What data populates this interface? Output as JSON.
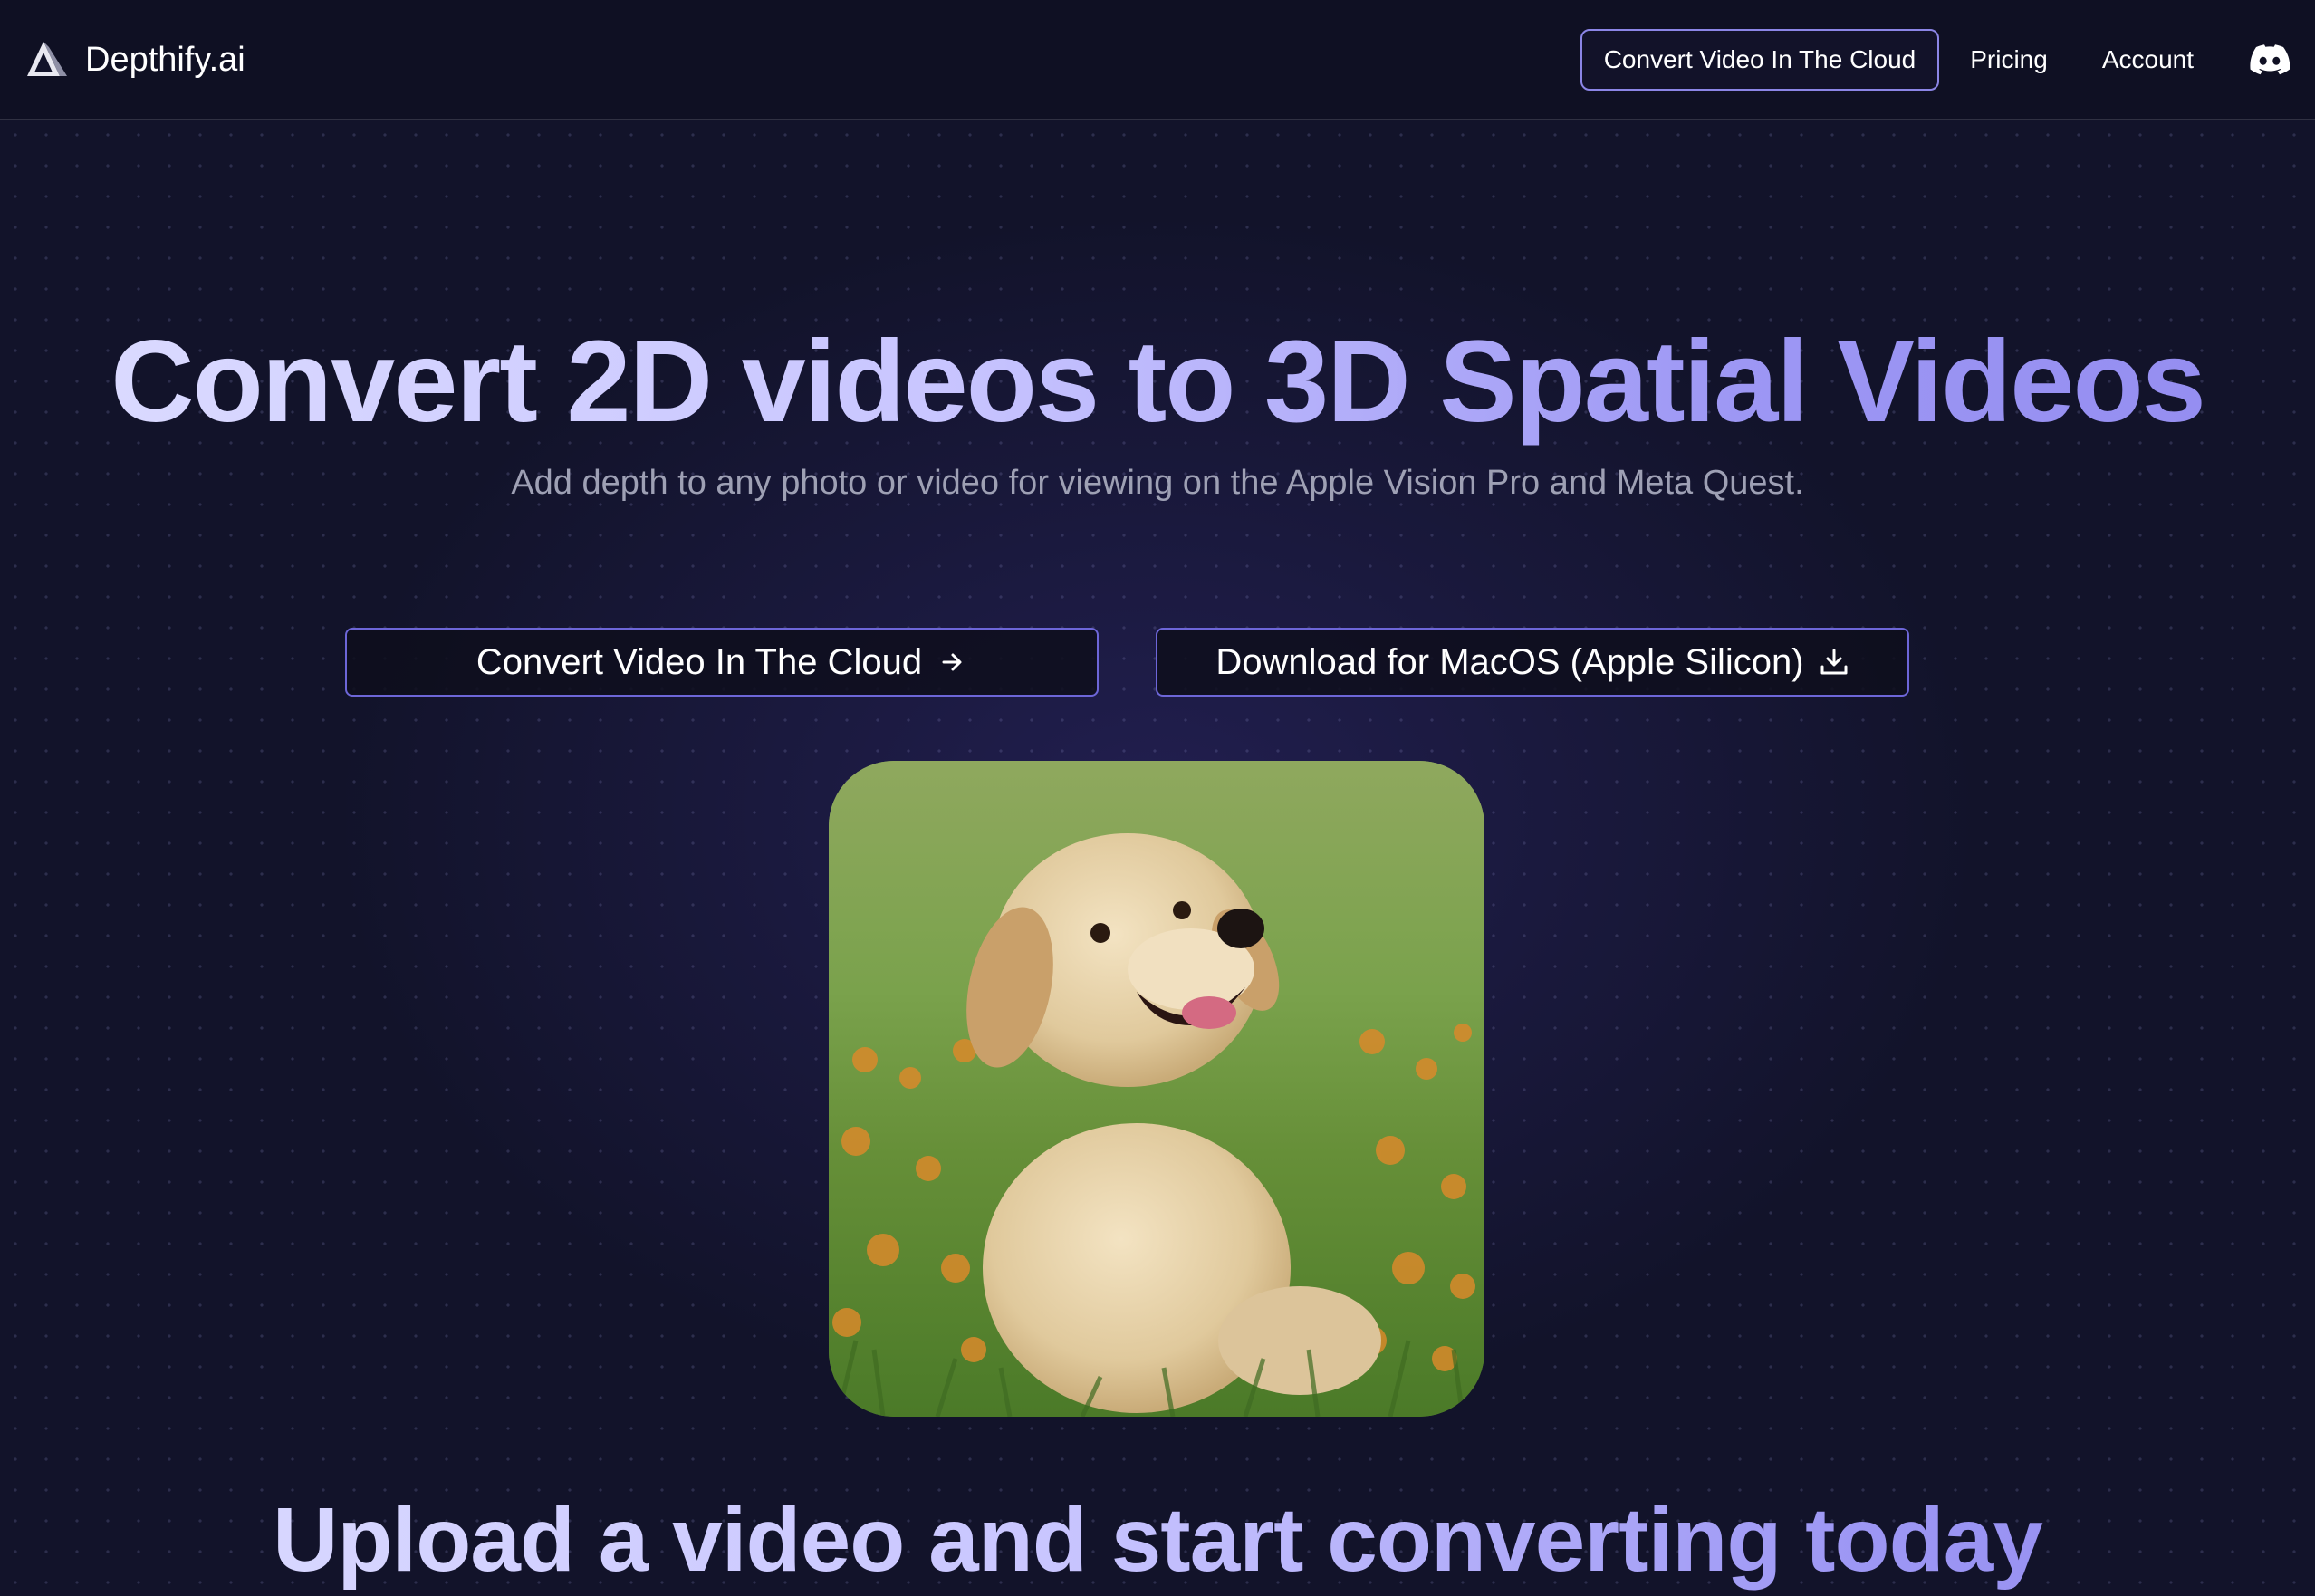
{
  "header": {
    "brand_name": "Depthify.ai",
    "brand_icon": "depthify-triangle-logo",
    "nav": {
      "cta_label": "Convert Video In The Cloud",
      "pricing_label": "Pricing",
      "account_label": "Account",
      "discord_icon": "discord-icon"
    }
  },
  "hero": {
    "title": "Convert 2D videos to 3D Spatial Videos",
    "subtitle": "Add depth to any photo or video for viewing on the Apple Vision Pro and Meta Quest.",
    "buttons": {
      "cloud_label": "Convert Video In The Cloud",
      "cloud_icon": "arrow-right-icon",
      "download_label": "Download for MacOS (Apple Silicon)",
      "download_icon": "download-icon"
    },
    "image": {
      "subject": "golden retriever puppy sitting in grass with orange flowers"
    }
  },
  "section": {
    "title": "Upload a video and start converting today"
  },
  "colors": {
    "background": "#12132a",
    "accent_border": "#8b85e6",
    "button_border": "#6d66d8",
    "title_gradient_start": "#dcdcff",
    "title_gradient_end": "#938cf0",
    "subtitle": "#9ea0b4"
  }
}
